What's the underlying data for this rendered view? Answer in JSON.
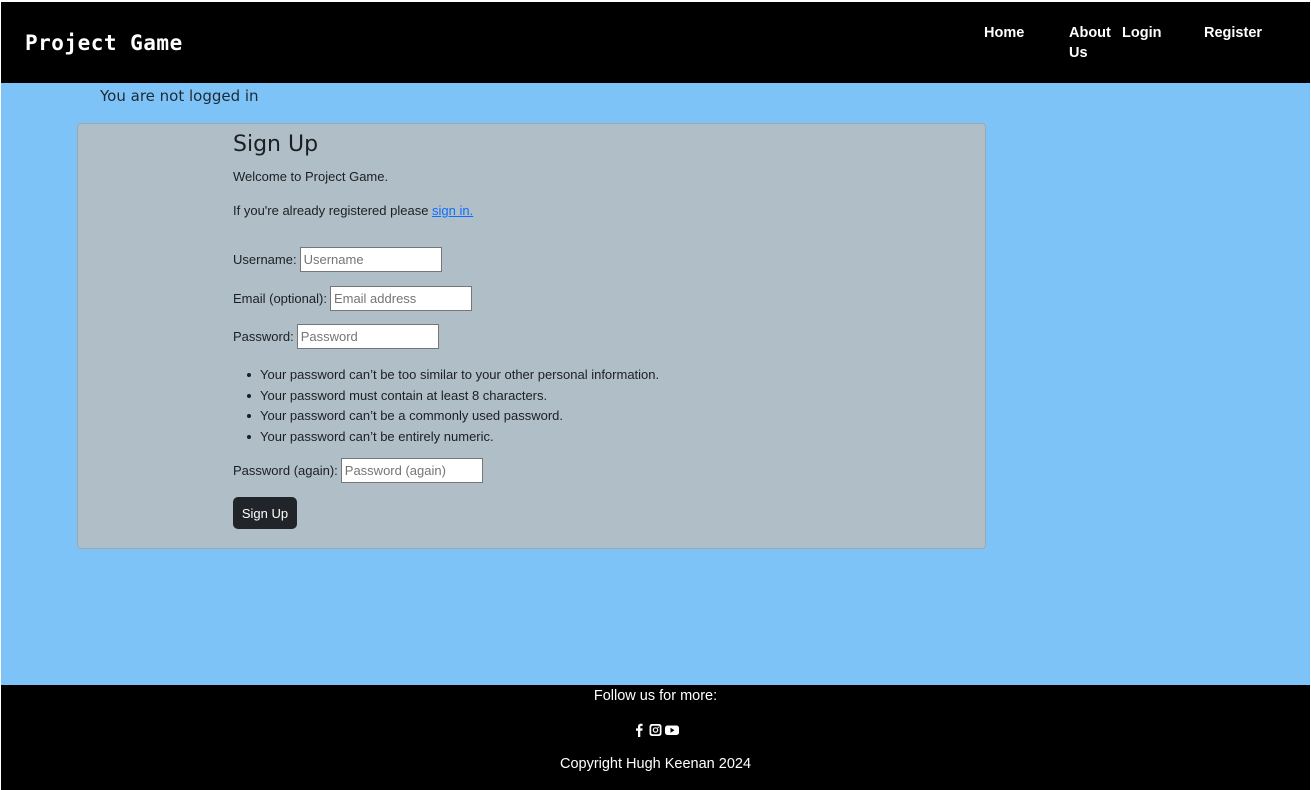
{
  "navbar": {
    "brand": "Project Game",
    "links": [
      "Home",
      "About Us",
      "Login",
      "Register"
    ]
  },
  "status": "You are not logged in",
  "signup": {
    "title": "Sign Up",
    "welcome": "Welcome to Project Game.",
    "already_prefix": "If you're already registered please ",
    "signin_link": "sign in.",
    "fields": {
      "username": {
        "label": "Username:",
        "placeholder": "Username"
      },
      "email": {
        "label": "Email (optional):",
        "placeholder": "Email address"
      },
      "password": {
        "label": "Password:",
        "placeholder": "Password"
      },
      "password2": {
        "label": "Password (again):",
        "placeholder": "Password (again)"
      }
    },
    "password_rules": [
      "Your password can’t be too similar to your other personal information.",
      "Your password must contain at least 8 characters.",
      "Your password can’t be a commonly used password.",
      "Your password can’t be entirely numeric."
    ],
    "submit_label": "Sign Up"
  },
  "footer": {
    "follow": "Follow us for more:",
    "social_icons": [
      "facebook-icon",
      "instagram-icon",
      "youtube-icon"
    ],
    "copyright": "Copyright Hugh Keenan 2024"
  },
  "colors": {
    "page_bg": "#7dc3f7",
    "card_bg": "#b0bec8",
    "nav_bg": "#000000",
    "link": "#0d6efd",
    "button_bg": "#212529"
  }
}
